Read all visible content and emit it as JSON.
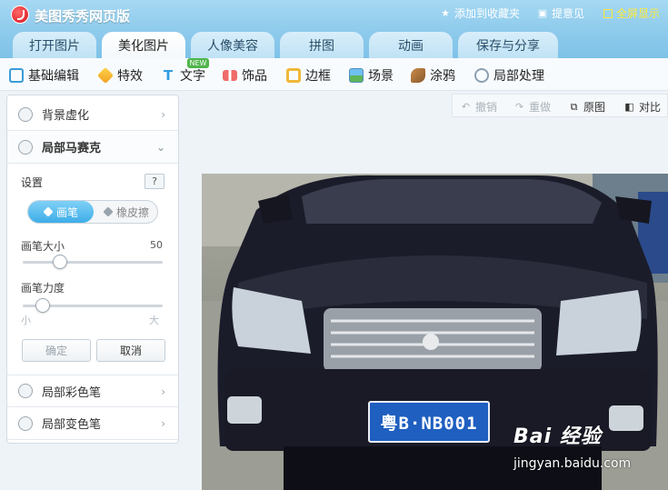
{
  "app": {
    "title": "美图秀秀网页版",
    "links": {
      "favorite": "添加到收藏夹",
      "feedback": "提意见",
      "fullscreen": "全屏显示"
    }
  },
  "tabs": [
    {
      "label": "打开图片",
      "active": false
    },
    {
      "label": "美化图片",
      "active": true
    },
    {
      "label": "人像美容",
      "active": false
    },
    {
      "label": "拼图",
      "active": false
    },
    {
      "label": "动画",
      "active": false
    },
    {
      "label": "保存与分享",
      "active": false
    }
  ],
  "tools": [
    {
      "label": "基础编辑",
      "icon": "basic-edit-icon"
    },
    {
      "label": "特效",
      "icon": "effects-icon"
    },
    {
      "label": "文字",
      "icon": "text-icon",
      "badge": "NEW"
    },
    {
      "label": "饰品",
      "icon": "accessory-icon"
    },
    {
      "label": "边框",
      "icon": "frame-icon"
    },
    {
      "label": "场景",
      "icon": "scene-icon"
    },
    {
      "label": "涂鸦",
      "icon": "doodle-icon"
    },
    {
      "label": "局部处理",
      "icon": "local-process-icon"
    }
  ],
  "panel": {
    "sections": {
      "background_blur": "背景虚化",
      "local_mosaic": "局部马赛克",
      "local_color_pen": "局部彩色笔",
      "local_recolor_pen": "局部变色笔"
    },
    "settings_label": "设置",
    "help": "?",
    "modes": {
      "pen": "画笔",
      "eraser": "橡皮擦",
      "selected": "pen"
    },
    "brush_size": {
      "label": "画笔大小",
      "value": "50",
      "level": 0.24
    },
    "brush_strength": {
      "label": "画笔力度",
      "level": 0.1,
      "min_label": "小",
      "max_label": "大"
    },
    "buttons": {
      "ok": "确定",
      "cancel": "取消"
    }
  },
  "canvas_tools": {
    "undo": "撤销",
    "redo": "重做",
    "original": "原图",
    "compare": "对比"
  },
  "photo": {
    "plate_text": "粤B·NB001"
  },
  "watermark": {
    "logo": "Bai 经验",
    "url": "jingyan.baidu.com"
  }
}
